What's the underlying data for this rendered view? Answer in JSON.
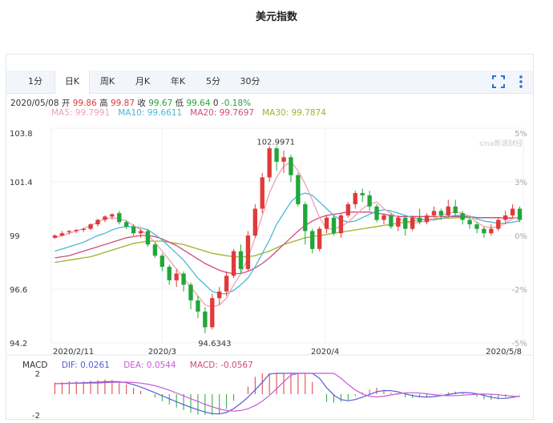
{
  "title": "美元指数",
  "tabs": [
    {
      "label": "1分",
      "active": false
    },
    {
      "label": "日K",
      "active": true
    },
    {
      "label": "周K",
      "active": false
    },
    {
      "label": "月K",
      "active": false
    },
    {
      "label": "年K",
      "active": false
    },
    {
      "label": "5分",
      "active": false
    },
    {
      "label": "30分",
      "active": false
    }
  ],
  "icons": {
    "fullscreen": "fullscreen-icon",
    "more": "more-vertical-icon"
  },
  "info": {
    "date": "2020/05/08",
    "open_label": "开",
    "open": "99.86",
    "high_label": "高",
    "high": "99.87",
    "close_label": "收",
    "close": "99.67",
    "low_label": "低",
    "low": "99.64",
    "volume": "0",
    "change": "-0.18%"
  },
  "ma": {
    "ma5": "MA5: 99.7991",
    "ma10": "MA10: 99.6611",
    "ma20": "MA20: 99.7697",
    "ma30": "MA30: 99.7874"
  },
  "watermark": "sina新浪财经",
  "macd": {
    "label": "MACD",
    "dif": "DIF: 0.0261",
    "dea": "DEA: 0.0544",
    "macd": "MACD: -0.0567",
    "y_ticks": [
      "2",
      "-2"
    ]
  },
  "colors": {
    "up": "#e03a3a",
    "down": "#22a63a",
    "ma5": "#f0a0b0",
    "ma10": "#4cb8d6",
    "ma20": "#d14a7e",
    "ma30": "#9db32b"
  },
  "chart_data": {
    "type": "candlestick",
    "y_ticks": [
      "103.8",
      "101.4",
      "99",
      "96.6",
      "94.2"
    ],
    "pct_ticks": [
      "5%",
      "3%",
      "0%",
      "-2%",
      "-5%"
    ],
    "ylim": [
      94.2,
      103.8
    ],
    "x_ticks": [
      "2020/2/11",
      "2020/3",
      "2020/4",
      "2020/5/8"
    ],
    "annotations": {
      "max": "102.9971",
      "min": "94.6343"
    },
    "candles": [
      [
        98.9,
        99.0,
        98.85,
        99.05
      ],
      [
        99.0,
        99.1,
        98.95,
        99.2
      ],
      [
        99.15,
        99.2,
        99.05,
        99.25
      ],
      [
        99.2,
        99.25,
        99.1,
        99.3
      ],
      [
        99.25,
        99.3,
        99.15,
        99.35
      ],
      [
        99.3,
        99.5,
        99.25,
        99.55
      ],
      [
        99.5,
        99.7,
        99.4,
        99.75
      ],
      [
        99.7,
        99.85,
        99.6,
        99.9
      ],
      [
        99.85,
        99.95,
        99.7,
        100.0
      ],
      [
        100.0,
        99.6,
        99.5,
        100.1
      ],
      [
        99.6,
        99.4,
        99.3,
        99.7
      ],
      [
        99.4,
        99.1,
        99.0,
        99.5
      ],
      [
        99.1,
        99.2,
        98.9,
        99.3
      ],
      [
        99.2,
        98.6,
        98.5,
        99.3
      ],
      [
        98.6,
        98.1,
        98.0,
        98.7
      ],
      [
        98.1,
        97.6,
        97.4,
        98.2
      ],
      [
        97.6,
        97.0,
        96.8,
        97.7
      ],
      [
        97.0,
        97.3,
        96.7,
        97.5
      ],
      [
        97.3,
        96.8,
        96.5,
        97.4
      ],
      [
        96.8,
        96.1,
        95.7,
        96.9
      ],
      [
        96.1,
        95.6,
        95.3,
        96.3
      ],
      [
        95.6,
        94.9,
        94.63,
        95.8
      ],
      [
        94.9,
        96.2,
        94.8,
        96.4
      ],
      [
        96.2,
        96.5,
        95.9,
        96.7
      ],
      [
        96.5,
        97.2,
        96.3,
        97.4
      ],
      [
        97.2,
        98.3,
        97.1,
        98.4
      ],
      [
        98.3,
        97.5,
        97.3,
        98.6
      ],
      [
        97.5,
        99.0,
        97.4,
        99.2
      ],
      [
        99.0,
        100.2,
        98.9,
        100.4
      ],
      [
        100.2,
        101.6,
        100.0,
        101.8
      ],
      [
        101.6,
        102.9,
        101.4,
        103.0
      ],
      [
        102.9,
        102.3,
        101.9,
        103.0
      ],
      [
        102.3,
        102.5,
        101.8,
        102.8
      ],
      [
        102.5,
        101.7,
        101.4,
        102.6
      ],
      [
        101.7,
        100.4,
        100.3,
        101.8
      ],
      [
        100.4,
        99.2,
        98.6,
        100.5
      ],
      [
        99.2,
        98.4,
        98.2,
        99.3
      ],
      [
        98.4,
        99.3,
        98.3,
        99.4
      ],
      [
        99.3,
        99.8,
        99.1,
        99.9
      ],
      [
        99.8,
        99.1,
        99.0,
        99.9
      ],
      [
        99.1,
        99.9,
        98.9,
        100.0
      ],
      [
        99.9,
        100.4,
        99.8,
        100.5
      ],
      [
        100.4,
        100.9,
        100.2,
        101.0
      ],
      [
        100.9,
        100.8,
        100.5,
        101.1
      ],
      [
        100.8,
        100.3,
        100.1,
        101.0
      ],
      [
        100.3,
        99.7,
        99.6,
        100.4
      ],
      [
        99.7,
        99.9,
        99.5,
        100.0
      ],
      [
        99.9,
        99.4,
        99.3,
        100.0
      ],
      [
        99.4,
        99.8,
        99.2,
        99.9
      ],
      [
        99.8,
        99.3,
        99.0,
        99.9
      ],
      [
        99.3,
        99.8,
        99.2,
        99.9
      ],
      [
        99.8,
        99.6,
        99.5,
        100.2
      ],
      [
        99.6,
        99.9,
        99.5,
        100.0
      ],
      [
        99.9,
        100.1,
        99.8,
        100.3
      ],
      [
        100.1,
        99.9,
        99.7,
        100.2
      ],
      [
        99.9,
        100.3,
        99.8,
        100.6
      ],
      [
        100.3,
        100.0,
        99.9,
        100.6
      ],
      [
        100.0,
        99.7,
        99.5,
        100.1
      ],
      [
        99.7,
        99.5,
        99.3,
        99.9
      ],
      [
        99.5,
        99.3,
        99.1,
        99.6
      ],
      [
        99.3,
        99.1,
        98.9,
        99.4
      ],
      [
        99.1,
        99.3,
        99.0,
        99.5
      ],
      [
        99.3,
        99.7,
        99.2,
        99.8
      ],
      [
        99.7,
        99.9,
        99.5,
        100.1
      ],
      [
        99.9,
        100.2,
        99.8,
        100.4
      ],
      [
        100.2,
        99.7,
        99.6,
        100.3
      ]
    ],
    "ma_lines": {
      "ma5": [
        98.9,
        99.0,
        99.1,
        99.2,
        99.3,
        99.45,
        99.6,
        99.75,
        99.8,
        99.75,
        99.65,
        99.45,
        99.25,
        99.0,
        98.7,
        98.3,
        97.9,
        97.5,
        97.1,
        96.7,
        96.3,
        95.9,
        95.8,
        95.9,
        96.2,
        96.8,
        97.3,
        98.0,
        98.9,
        99.9,
        100.9,
        101.6,
        102.1,
        102.3,
        101.9,
        101.3,
        100.6,
        99.8,
        99.3,
        99.3,
        99.4,
        99.6,
        99.9,
        100.2,
        100.4,
        100.5,
        100.2,
        100.0,
        99.8,
        99.6,
        99.55,
        99.6,
        99.65,
        99.75,
        99.9,
        100.0,
        100.05,
        100.0,
        99.85,
        99.6,
        99.4,
        99.35,
        99.4,
        99.55,
        99.75,
        99.8
      ],
      "ma10": [
        98.3,
        98.4,
        98.5,
        98.6,
        98.7,
        98.85,
        99.0,
        99.1,
        99.25,
        99.35,
        99.4,
        99.4,
        99.35,
        99.25,
        99.05,
        98.8,
        98.5,
        98.2,
        97.9,
        97.5,
        97.1,
        96.8,
        96.5,
        96.4,
        96.4,
        96.55,
        96.8,
        97.1,
        97.6,
        98.2,
        98.8,
        99.5,
        100.0,
        100.5,
        100.8,
        100.9,
        100.8,
        100.5,
        100.2,
        99.9,
        99.7,
        99.6,
        99.65,
        99.8,
        99.95,
        100.1,
        100.15,
        100.1,
        100.0,
        99.9,
        99.8,
        99.75,
        99.7,
        99.7,
        99.75,
        99.85,
        99.9,
        99.9,
        99.85,
        99.75,
        99.65,
        99.6,
        99.55,
        99.55,
        99.6,
        99.66
      ],
      "ma20": [
        98.0,
        98.05,
        98.1,
        98.2,
        98.3,
        98.4,
        98.5,
        98.6,
        98.7,
        98.8,
        98.9,
        98.95,
        99.0,
        99.0,
        98.95,
        98.85,
        98.7,
        98.55,
        98.35,
        98.15,
        97.95,
        97.75,
        97.6,
        97.45,
        97.35,
        97.3,
        97.3,
        97.4,
        97.55,
        97.75,
        98.0,
        98.3,
        98.6,
        98.9,
        99.2,
        99.45,
        99.65,
        99.8,
        99.9,
        99.95,
        100.0,
        100.05,
        100.05,
        100.05,
        100.05,
        100.0,
        99.95,
        99.9,
        99.85,
        99.85,
        99.85,
        99.85,
        99.85,
        99.85,
        99.85,
        99.85,
        99.85,
        99.85,
        99.85,
        99.8,
        99.8,
        99.8,
        99.8,
        99.78,
        99.77,
        99.77
      ],
      "ma30": [
        97.8,
        97.85,
        97.9,
        97.95,
        98.0,
        98.05,
        98.15,
        98.25,
        98.35,
        98.45,
        98.55,
        98.65,
        98.7,
        98.75,
        98.75,
        98.75,
        98.7,
        98.65,
        98.6,
        98.5,
        98.4,
        98.3,
        98.2,
        98.15,
        98.1,
        98.05,
        98.05,
        98.05,
        98.1,
        98.2,
        98.3,
        98.45,
        98.6,
        98.7,
        98.8,
        98.9,
        98.95,
        99.0,
        99.05,
        99.1,
        99.15,
        99.2,
        99.25,
        99.3,
        99.35,
        99.4,
        99.45,
        99.5,
        99.55,
        99.6,
        99.65,
        99.7,
        99.72,
        99.75,
        99.77,
        99.78,
        99.79,
        99.8,
        99.8,
        99.8,
        99.8,
        99.79,
        99.79,
        99.79,
        99.79,
        99.79
      ]
    }
  }
}
